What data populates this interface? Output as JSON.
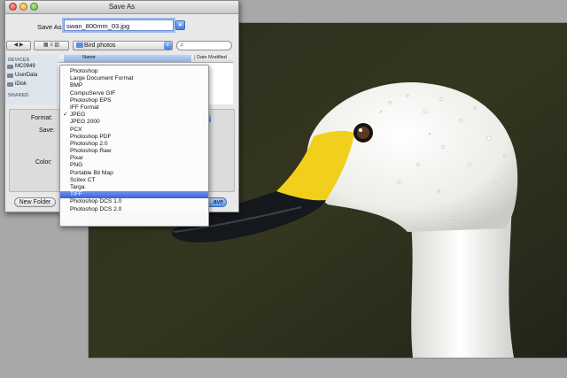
{
  "dialog": {
    "title": "Save As",
    "save_as_label": "Save As:",
    "filename": "swan_800mm_03.jpg",
    "location": "Bird photos",
    "format_label": "Format:",
    "save_label": "Save:",
    "color_label": "Color:",
    "new_folder_label": "New Folder",
    "save_button_label": "ave",
    "sidebar": {
      "devices_header": "DEVICES",
      "items": [
        "MC0949",
        "UserData",
        "iDisk"
      ],
      "shared_header": "SHARED"
    },
    "columns": {
      "name": "Name",
      "date": "Date Modified"
    }
  },
  "format_menu": {
    "items": [
      "Photoshop",
      "Large Document Format",
      "BMP",
      "CompuServe GIF",
      "Photoshop EPS",
      "IFF Format",
      "JPEG",
      "JPEG 2000",
      "PCX",
      "Photoshop PDF",
      "Photoshop 2.0",
      "Photoshop Raw",
      "Pixar",
      "PNG",
      "Portable Bit Map",
      "Scitex CT",
      "Targa",
      "TIFF",
      "Photoshop DCS 1.0",
      "Photoshop DCS 2.0"
    ],
    "checked": "JPEG",
    "highlighted": "TIFF"
  },
  "colors": {
    "photo_background": "#2a2c1a",
    "selection": "#3a62d8",
    "beak_yellow": "#f2cf1c"
  },
  "icons": [
    "back-forward-icon",
    "view-mode-icon",
    "folder-icon",
    "search-icon",
    "checkmark-icon"
  ]
}
